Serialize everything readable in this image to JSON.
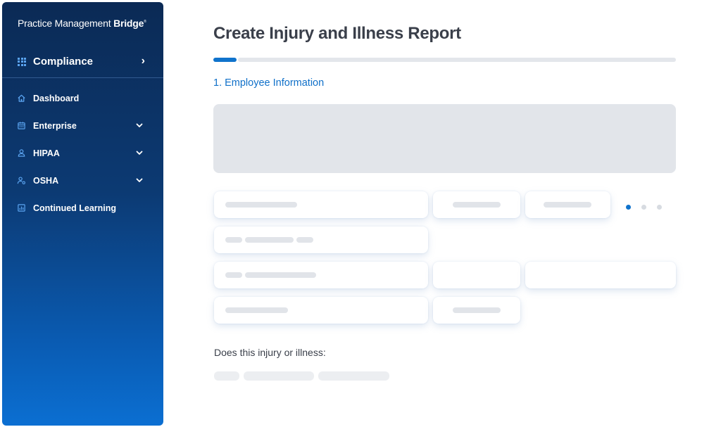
{
  "brand": {
    "name_regular": "Practice Management ",
    "name_bold": "Bridge",
    "mark": "®"
  },
  "module": {
    "label": "Compliance",
    "icon": "grid-icon",
    "chevron": "›"
  },
  "nav": {
    "items": [
      {
        "label": "Dashboard",
        "icon": "home-icon",
        "expandable": false
      },
      {
        "label": "Enterprise",
        "icon": "calendar-icon",
        "expandable": true
      },
      {
        "label": "HIPAA",
        "icon": "user-icon",
        "expandable": true
      },
      {
        "label": "OSHA",
        "icon": "user-gear-icon",
        "expandable": true
      },
      {
        "label": "Continued Learning",
        "icon": "chart-icon",
        "expandable": false
      }
    ]
  },
  "page": {
    "title": "Create Injury and Illness Report",
    "section_title": "1. Employee Information",
    "progress_fraction": 0.05,
    "question": "Does this injury or illness:"
  },
  "carousel": {
    "count": 3,
    "active": 0
  },
  "colors": {
    "accent": "#1073cc",
    "sidebar_top": "#0b2a55",
    "sidebar_bottom": "#0b6fd2",
    "title": "#3a3f4a"
  }
}
